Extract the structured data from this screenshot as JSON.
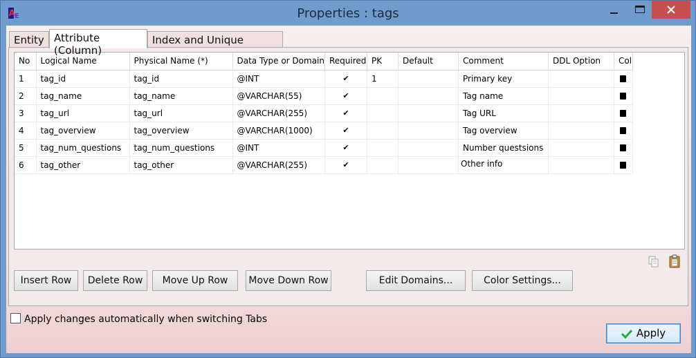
{
  "window": {
    "title": "Properties : tags"
  },
  "tabs": [
    {
      "label": "Entity",
      "active": false
    },
    {
      "label": "Attribute (Column)",
      "active": true
    },
    {
      "label": "Index and Unique Constraint",
      "active": false
    }
  ],
  "table": {
    "columns": [
      "No",
      "Logical Name",
      "Physical Name (*)",
      "Data Type or Domain",
      "Required",
      "PK",
      "Default",
      "Comment",
      "DDL Option",
      "Col"
    ],
    "rows": [
      {
        "no": "1",
        "logical": "tag_id",
        "physical": "tag_id",
        "type": "@INT",
        "required": "✔",
        "pk": "1",
        "default": "",
        "comment": "Primary key",
        "ddl": ""
      },
      {
        "no": "2",
        "logical": "tag_name",
        "physical": "tag_name",
        "type": "@VARCHAR(55)",
        "required": "✔",
        "pk": "",
        "default": "",
        "comment": "Tag name",
        "ddl": ""
      },
      {
        "no": "3",
        "logical": "tag_url",
        "physical": "tag_url",
        "type": "@VARCHAR(255)",
        "required": "✔",
        "pk": "",
        "default": "",
        "comment": "Tag URL",
        "ddl": ""
      },
      {
        "no": "4",
        "logical": "tag_overview",
        "physical": "tag_overview",
        "type": "@VARCHAR(1000)",
        "required": "✔",
        "pk": "",
        "default": "",
        "comment": "Tag overview",
        "ddl": ""
      },
      {
        "no": "5",
        "logical": "tag_num_questions",
        "physical": "tag_num_questions",
        "type": "@INT",
        "required": "✔",
        "pk": "",
        "default": "",
        "comment": "Number questsions",
        "ddl": ""
      },
      {
        "no": "6",
        "logical": "tag_other",
        "physical": "tag_other",
        "type": "@VARCHAR(255)",
        "required": "✔",
        "pk": "",
        "default": "",
        "comment": "Other info",
        "ddl": ""
      }
    ]
  },
  "buttons": {
    "insert_row": "Insert Row",
    "delete_row": "Delete Row",
    "move_up_row": "Move Up Row",
    "move_down_row": "Move Down Row",
    "edit_domains": "Edit Domains...",
    "color_settings": "Color Settings...",
    "apply": "Apply"
  },
  "auto_apply": {
    "label": "Apply changes automatically when switching Tabs",
    "checked": false
  },
  "colors": {
    "titlebar": "#6f9bcd",
    "close_button": "#c74f50",
    "client_bg": "#f4e3e3",
    "apply_border": "#3a84d6",
    "apply_check": "#2fa83a"
  }
}
